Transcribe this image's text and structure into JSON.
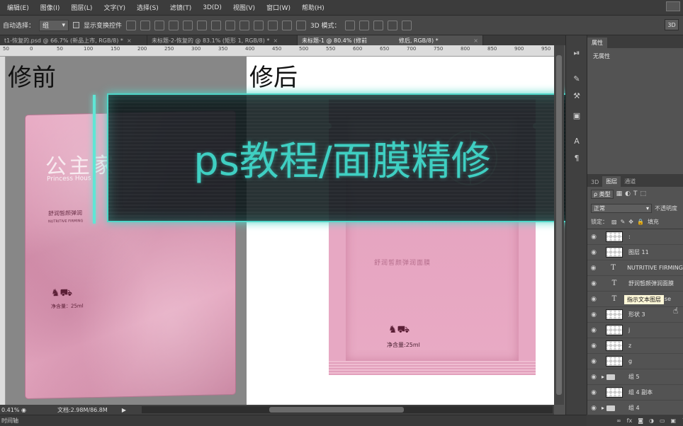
{
  "menu": [
    "编辑(E)",
    "图像(I)",
    "图层(L)",
    "文字(Y)",
    "选择(S)",
    "滤镜(T)",
    "3D(D)",
    "视图(V)",
    "窗口(W)",
    "帮助(H)"
  ],
  "options": {
    "auto_select_label": "自动选择：",
    "auto_select_value": "组",
    "show_transform_label": "显示变换控件",
    "mode_3d_label": "3D 模式：",
    "btn_3d": "3D"
  },
  "tabs": [
    {
      "label": "t1-恢复的.psd @ 66.7% (新品上市, RGB/8) *",
      "active": false
    },
    {
      "label": "未标题-2-恢复的 @ 83.1% (矩形 1, RGB/8) *",
      "active": false
    },
    {
      "label": "未标题-1 @ 80.4% (修前",
      "active": true
    },
    {
      "label": "修后, RGB/8) *",
      "active": false
    }
  ],
  "ruler": [
    "50",
    "0",
    "50",
    "100",
    "150",
    "200",
    "250",
    "300",
    "350",
    "400",
    "450",
    "500",
    "550",
    "600",
    "650",
    "700",
    "750",
    "800",
    "850",
    "900",
    "950"
  ],
  "canvas": {
    "before_caption": "修前",
    "after_caption": "修后",
    "before_bag": {
      "brand": "公主家",
      "brand_en": "Princess Hous",
      "title": "舒润皙颜弹润",
      "subtitle": "NUTRITIVE FIRMING",
      "net": "净含量：25ml"
    },
    "after_bag": {
      "title": "舒润皙颜弹润面膜",
      "net": "净含量:25ml"
    }
  },
  "banner": {
    "text": "ps教程/面膜精修"
  },
  "status": {
    "zoom": "0.41%",
    "doc": "文档:2.98M/86.8M"
  },
  "bottom": {
    "label": "时间轴"
  },
  "properties": {
    "tab": "属性",
    "body": "无属性"
  },
  "layers_panel": {
    "tabs": [
      {
        "label": "3D",
        "active": false
      },
      {
        "label": "图层",
        "active": true
      },
      {
        "label": "通道",
        "active": false
      }
    ],
    "filter_kind": "ρ 类型",
    "blend_mode": "正常",
    "opacity_label": "不透明度",
    "lock_label": "锁定：",
    "fill_label": "填充",
    "tooltip": "指示文本图层",
    "layers": [
      {
        "name": ":",
        "kind": "pixel"
      },
      {
        "name": "图层 11",
        "kind": "pixel"
      },
      {
        "name": "NUTRITIVE FIRMING",
        "kind": "text"
      },
      {
        "name": "舒润皙颜弹润面膜",
        "kind": "text"
      },
      {
        "name": "princess house",
        "kind": "text"
      },
      {
        "name": "形状 3",
        "kind": "pixel"
      },
      {
        "name": "j",
        "kind": "pixel"
      },
      {
        "name": "z",
        "kind": "pixel"
      },
      {
        "name": "g",
        "kind": "pixel"
      },
      {
        "name": "组 5",
        "kind": "group"
      },
      {
        "name": "组 4 副本",
        "kind": "pixel"
      },
      {
        "name": "组 4",
        "kind": "group"
      }
    ]
  }
}
